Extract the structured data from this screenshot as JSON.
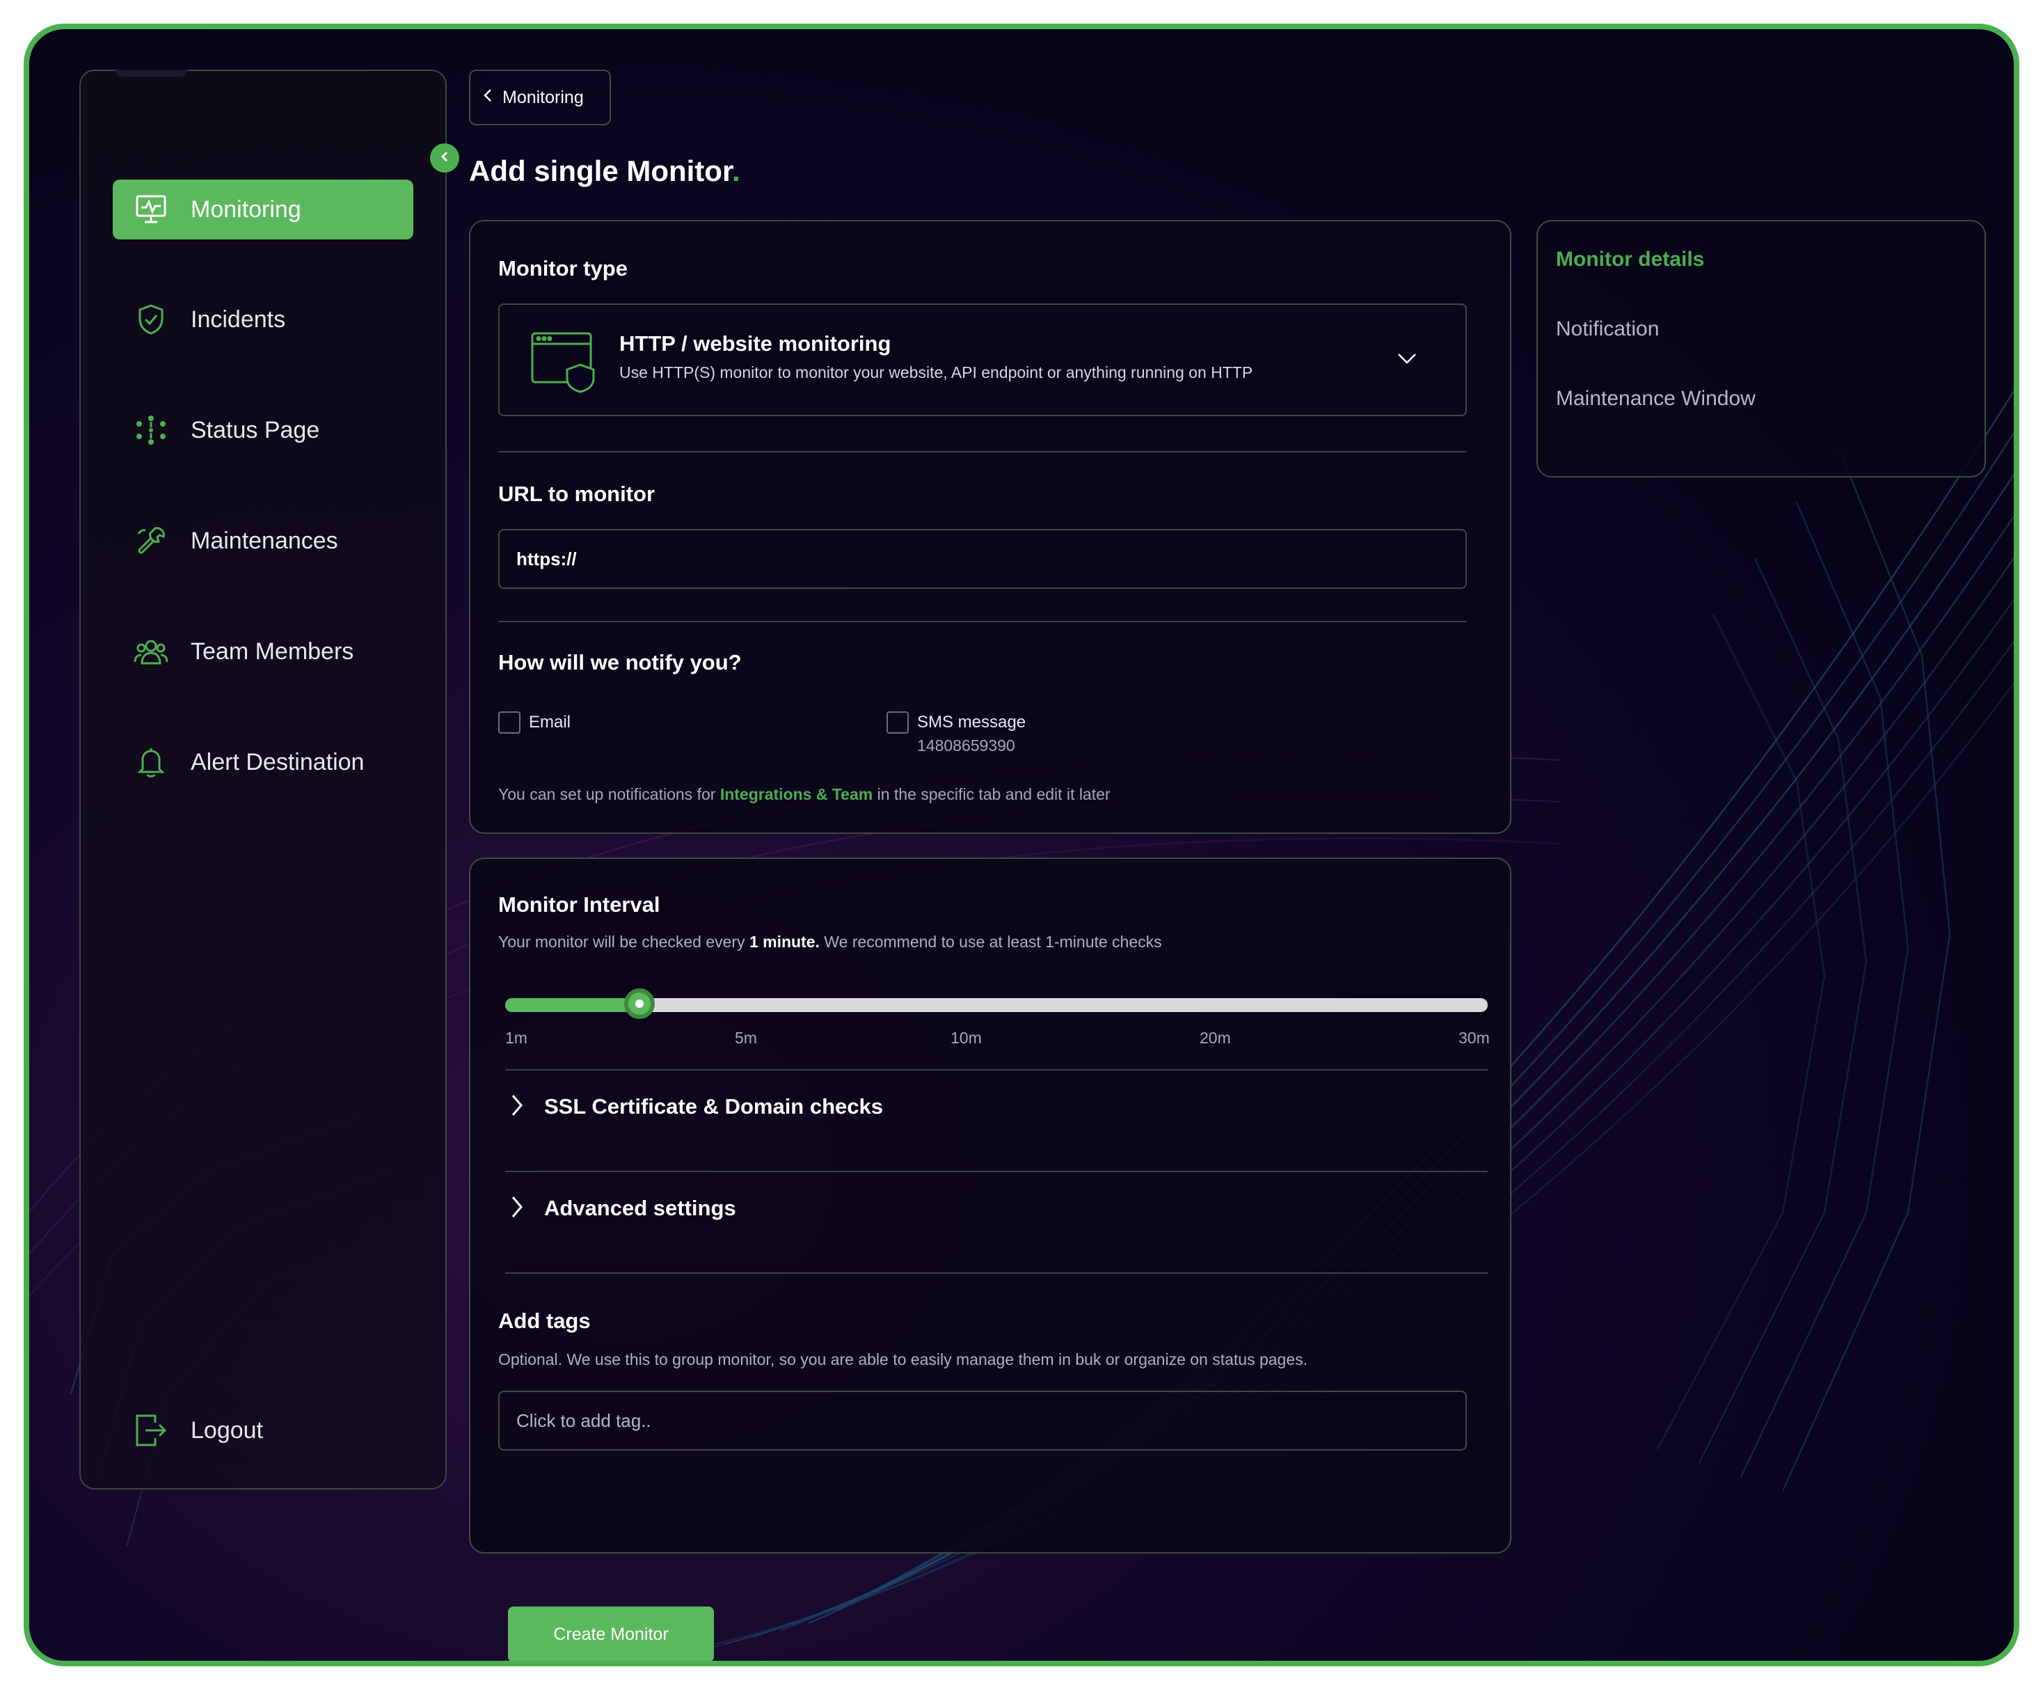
{
  "colors": {
    "accent": "#4caf50",
    "active_bg": "#5cb85c",
    "background": "#0a0620",
    "border": "#3c4c3e"
  },
  "sidebar": {
    "items": [
      {
        "label": "Monitoring",
        "icon": "monitor-icon",
        "active": true
      },
      {
        "label": "Incidents",
        "icon": "shield-check-icon",
        "active": false
      },
      {
        "label": "Status Page",
        "icon": "status-spark-icon",
        "active": false
      },
      {
        "label": "Maintenances",
        "icon": "wrench-icon",
        "active": false
      },
      {
        "label": "Team Members",
        "icon": "team-icon",
        "active": false
      },
      {
        "label": "Alert Destination",
        "icon": "bell-icon",
        "active": false
      }
    ],
    "logout_label": "Logout",
    "logout_icon": "logout-icon",
    "collapse_icon": "chevron-left-icon"
  },
  "header": {
    "back_label": "Monitoring",
    "title": "Add single Monitor",
    "title_dot": "."
  },
  "monitor_type": {
    "section_label": "Monitor type",
    "selected_title": "HTTP / website monitoring",
    "selected_desc": "Use HTTP(S) monitor to monitor your website, API endpoint or anything running on HTTP",
    "icon": "browser-shield-icon",
    "dropdown_icon": "chevron-down-icon"
  },
  "url": {
    "label": "URL to monitor",
    "value": "https://"
  },
  "notify": {
    "label": "How will we notify you?",
    "email_label": "Email",
    "email_checked": false,
    "sms_label": "SMS message",
    "sms_number": "14808659390",
    "sms_checked": false,
    "hint_before": "You can set up notifications for ",
    "hint_link": "Integrations & Team",
    "hint_after": " in the specific tab and edit it later"
  },
  "interval": {
    "label": "Monitor Interval",
    "desc_before": "Your monitor will be checked every ",
    "desc_bold": "1 minute.",
    "desc_after": " We recommend to use at least 1-minute checks",
    "ticks": [
      "1m",
      "5m",
      "10m",
      "20m",
      "30m"
    ],
    "value_fraction": 0.137
  },
  "accordions": [
    {
      "label": "SSL Certificate & Domain checks",
      "icon": "chevron-right-icon"
    },
    {
      "label": "Advanced settings",
      "icon": "chevron-right-icon"
    }
  ],
  "tags": {
    "label": "Add tags",
    "desc": "Optional. We use this to group monitor, so you are able to easily manage them in buk or organize on status pages.",
    "placeholder": "Click to add tag.."
  },
  "side_nav": {
    "items": [
      {
        "label": "Monitor details",
        "active": true
      },
      {
        "label": "Notification",
        "active": false
      },
      {
        "label": "Maintenance Window",
        "active": false
      }
    ]
  },
  "actions": {
    "create_label": "Create Monitor"
  }
}
